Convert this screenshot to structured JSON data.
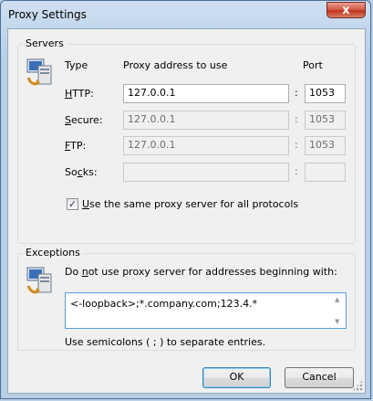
{
  "window": {
    "title": "Proxy Settings",
    "close_glyph": "x"
  },
  "servers": {
    "group_label": "Servers",
    "col_type": "Type",
    "col_address": "Proxy address to use",
    "col_port": "Port",
    "separator": ":",
    "rows": [
      {
        "label_ul": "H",
        "label_rest": "TTP:",
        "address": "127.0.0.1",
        "port": "1053",
        "enabled": true
      },
      {
        "label_ul": "S",
        "label_rest": "ecure:",
        "address": "127.0.0.1",
        "port": "1053",
        "enabled": false
      },
      {
        "label_ul": "F",
        "label_rest": "TP:",
        "address": "127.0.0.1",
        "port": "1053",
        "enabled": false
      },
      {
        "label_pre": "So",
        "label_ul": "c",
        "label_rest": "ks:",
        "address": "",
        "port": "",
        "enabled": false
      }
    ],
    "same_proxy": {
      "checked": true,
      "mark": "✓",
      "ul": "U",
      "rest": "se the same proxy server for all protocols"
    }
  },
  "exceptions": {
    "group_label": "Exceptions",
    "instr_pre": "Do ",
    "instr_ul": "n",
    "instr_rest": "ot use proxy server for addresses beginning with:",
    "value": "<-loopback>;*.company.com;123.4.*",
    "hint": "Use semicolons ( ; ) to separate entries."
  },
  "buttons": {
    "ok": "OK",
    "cancel": "Cancel"
  },
  "icons": {
    "servers": "proxy-network-icon",
    "exceptions": "proxy-network-icon"
  }
}
